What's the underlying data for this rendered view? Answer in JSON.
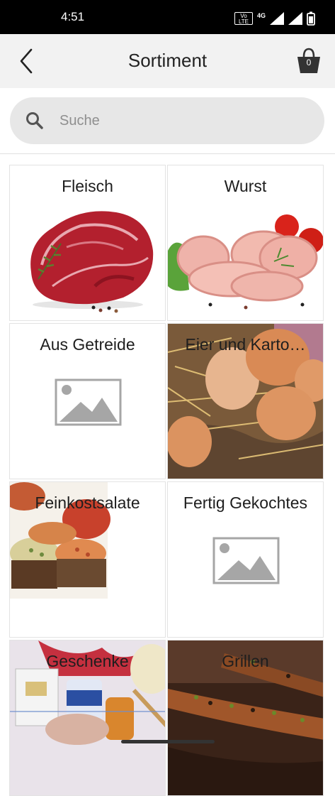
{
  "status_bar": {
    "time": "4:51",
    "volte": "Vo LTE",
    "network": "4G"
  },
  "header": {
    "title": "Sortiment",
    "cart_count": "0"
  },
  "search": {
    "placeholder": "Suche"
  },
  "categories": [
    {
      "label": "Fleisch"
    },
    {
      "label": "Wurst"
    },
    {
      "label": "Aus Getreide"
    },
    {
      "label": "Eier und Karto…"
    },
    {
      "label": "Feinkostsalate"
    },
    {
      "label": "Fertig Gekochtes"
    },
    {
      "label": "Geschenke"
    },
    {
      "label": "Grillen"
    }
  ]
}
